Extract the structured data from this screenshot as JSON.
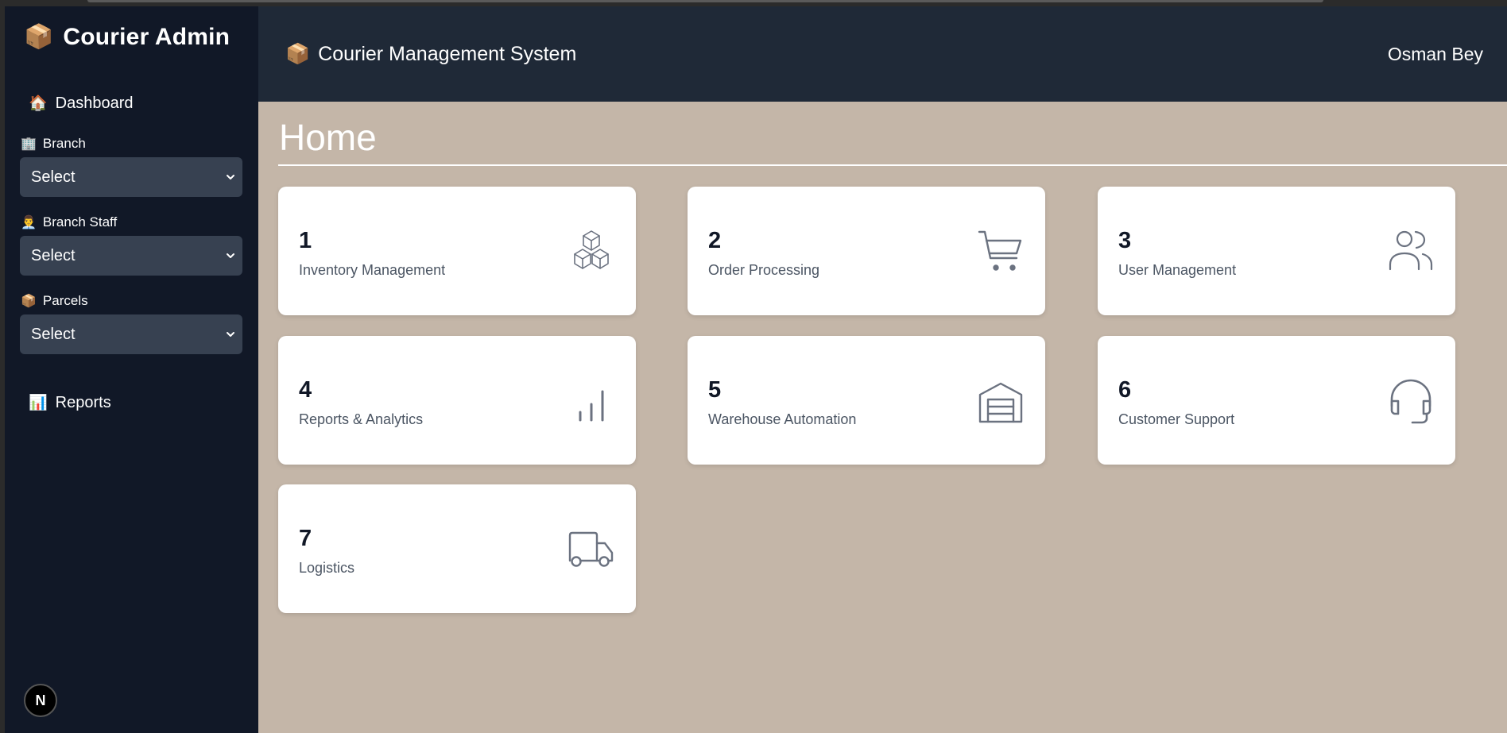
{
  "sidebar": {
    "brand": {
      "emoji": "📦",
      "title": "Courier Admin"
    },
    "dashboard": {
      "emoji": "🏠",
      "label": "Dashboard"
    },
    "groups": [
      {
        "emoji": "🏢",
        "label": "Branch",
        "select_value": "Select"
      },
      {
        "emoji": "👨‍💼",
        "label": "Branch Staff",
        "select_value": "Select"
      },
      {
        "emoji": "📦",
        "label": "Parcels",
        "select_value": "Select"
      }
    ],
    "reports": {
      "emoji": "📊",
      "label": "Reports"
    },
    "badge": "N"
  },
  "header": {
    "emoji": "📦",
    "title": "Courier Management System",
    "user": "Osman Bey"
  },
  "main": {
    "title": "Home",
    "cards": [
      {
        "number": "1",
        "label": "Inventory Management",
        "icon": "cubes-icon"
      },
      {
        "number": "2",
        "label": "Order Processing",
        "icon": "cart-icon"
      },
      {
        "number": "3",
        "label": "User Management",
        "icon": "users-icon"
      },
      {
        "number": "4",
        "label": "Reports & Analytics",
        "icon": "bar-chart-icon"
      },
      {
        "number": "5",
        "label": "Warehouse Automation",
        "icon": "warehouse-icon"
      },
      {
        "number": "6",
        "label": "Customer Support",
        "icon": "headset-icon"
      },
      {
        "number": "7",
        "label": "Logistics",
        "icon": "truck-icon"
      }
    ]
  },
  "colors": {
    "sidebar_bg": "#111827",
    "header_bg": "#1f2937",
    "main_bg": "#c4b6a8",
    "select_bg": "#374151",
    "card_bg": "#ffffff",
    "icon_stroke": "#6b7280"
  }
}
